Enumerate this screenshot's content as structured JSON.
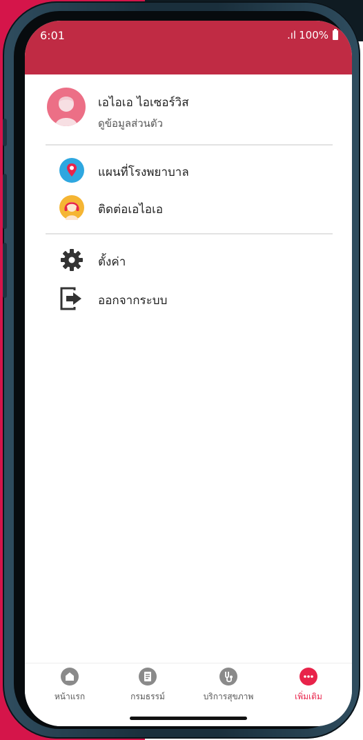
{
  "status_bar": {
    "time": "6:01",
    "signal": ".ıl",
    "battery": "100%"
  },
  "profile": {
    "name": "เอไอเอ ไอเซอร์วิส",
    "subtitle": "ดูข้อมูลส่วนตัว"
  },
  "menu": {
    "group1": [
      {
        "label": "แผนที่โรงพยาบาล",
        "icon": "map-pin-icon"
      },
      {
        "label": "ติดต่อเอไอเอ",
        "icon": "call-center-icon"
      }
    ],
    "group2": [
      {
        "label": "ตั้งค่า",
        "icon": "gear-icon"
      },
      {
        "label": "ออกจากระบบ",
        "icon": "logout-icon"
      }
    ]
  },
  "tabbar": {
    "items": [
      {
        "label": "หน้าแรก",
        "icon": "home-icon"
      },
      {
        "label": "กรมธรรม์",
        "icon": "policy-icon"
      },
      {
        "label": "บริการสุขภาพ",
        "icon": "stethoscope-icon"
      },
      {
        "label": "เพิ่มเติม",
        "icon": "more-icon",
        "active": true
      }
    ]
  },
  "colors": {
    "header": "#c02b44",
    "accent": "#e8234a",
    "background_left": "#d5154a"
  }
}
